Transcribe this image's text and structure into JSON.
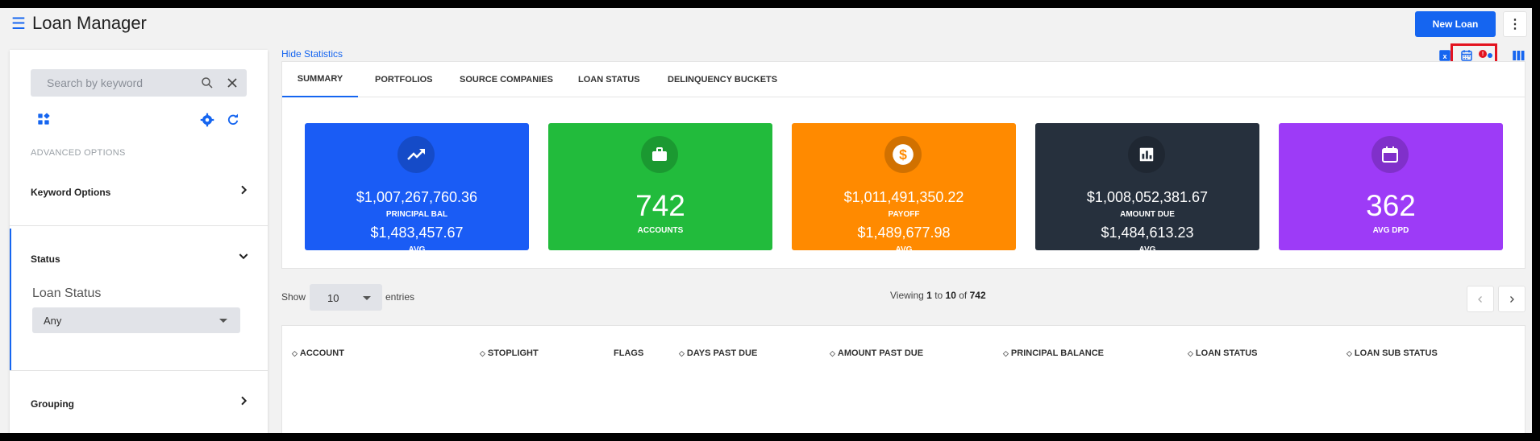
{
  "header": {
    "menu_icon": "hamburger-icon",
    "title": "Loan Manager",
    "new_loan_label": "New Loan",
    "more_icon": "kebab-icon"
  },
  "sidebar": {
    "search_placeholder": "Search by keyword",
    "advanced_label": "ADVANCED OPTIONS",
    "sections": {
      "keyword_options": "Keyword Options",
      "status": "Status",
      "grouping": "Grouping"
    },
    "loan_status_label": "Loan Status",
    "loan_status_value": "Any"
  },
  "main": {
    "hide_stats_label": "Hide Statistics",
    "calendar_badge": "!",
    "tabs": [
      "SUMMARY",
      "PORTFOLIOS",
      "SOURCE COMPANIES",
      "LOAN STATUS",
      "DELINQUENCY BUCKETS"
    ],
    "cards": [
      {
        "value1": "$1,007,267,760.36",
        "label1": "PRINCIPAL BAL",
        "value2": "$1,483,457.67",
        "label2": "AVG",
        "color": "#1a5cf5",
        "icon": "trending-up-icon"
      },
      {
        "big": "742",
        "label1": "ACCOUNTS",
        "color": "#22bb3c",
        "icon": "briefcase-icon"
      },
      {
        "value1": "$1,011,491,350.22",
        "label1": "PAYOFF",
        "value2": "$1,489,677.98",
        "label2": "AVG",
        "color": "#ff8a00",
        "icon": "dollar-icon"
      },
      {
        "value1": "$1,008,052,381.67",
        "label1": "AMOUNT DUE",
        "value2": "$1,484,613.23",
        "label2": "AVG",
        "color": "#26303d",
        "icon": "bar-chart-icon"
      },
      {
        "big": "362",
        "label1": "AVG DPD",
        "color": "#9d3bf7",
        "icon": "calendar-icon"
      }
    ],
    "table_controls": {
      "show_label": "Show",
      "entries_value": "10",
      "entries_label": "entries",
      "viewing_prefix": "Viewing",
      "viewing_from": "1",
      "viewing_to_word": "to",
      "viewing_to": "10",
      "viewing_of_word": "of",
      "viewing_total": "742"
    },
    "table_headers": [
      "ACCOUNT",
      "STOPLIGHT",
      "FLAGS",
      "DAYS PAST DUE",
      "AMOUNT PAST DUE",
      "PRINCIPAL BALANCE",
      "LOAN STATUS",
      "LOAN SUB STATUS"
    ]
  },
  "colors": {
    "accent": "#1565f0",
    "highlight": "#e3131f"
  }
}
